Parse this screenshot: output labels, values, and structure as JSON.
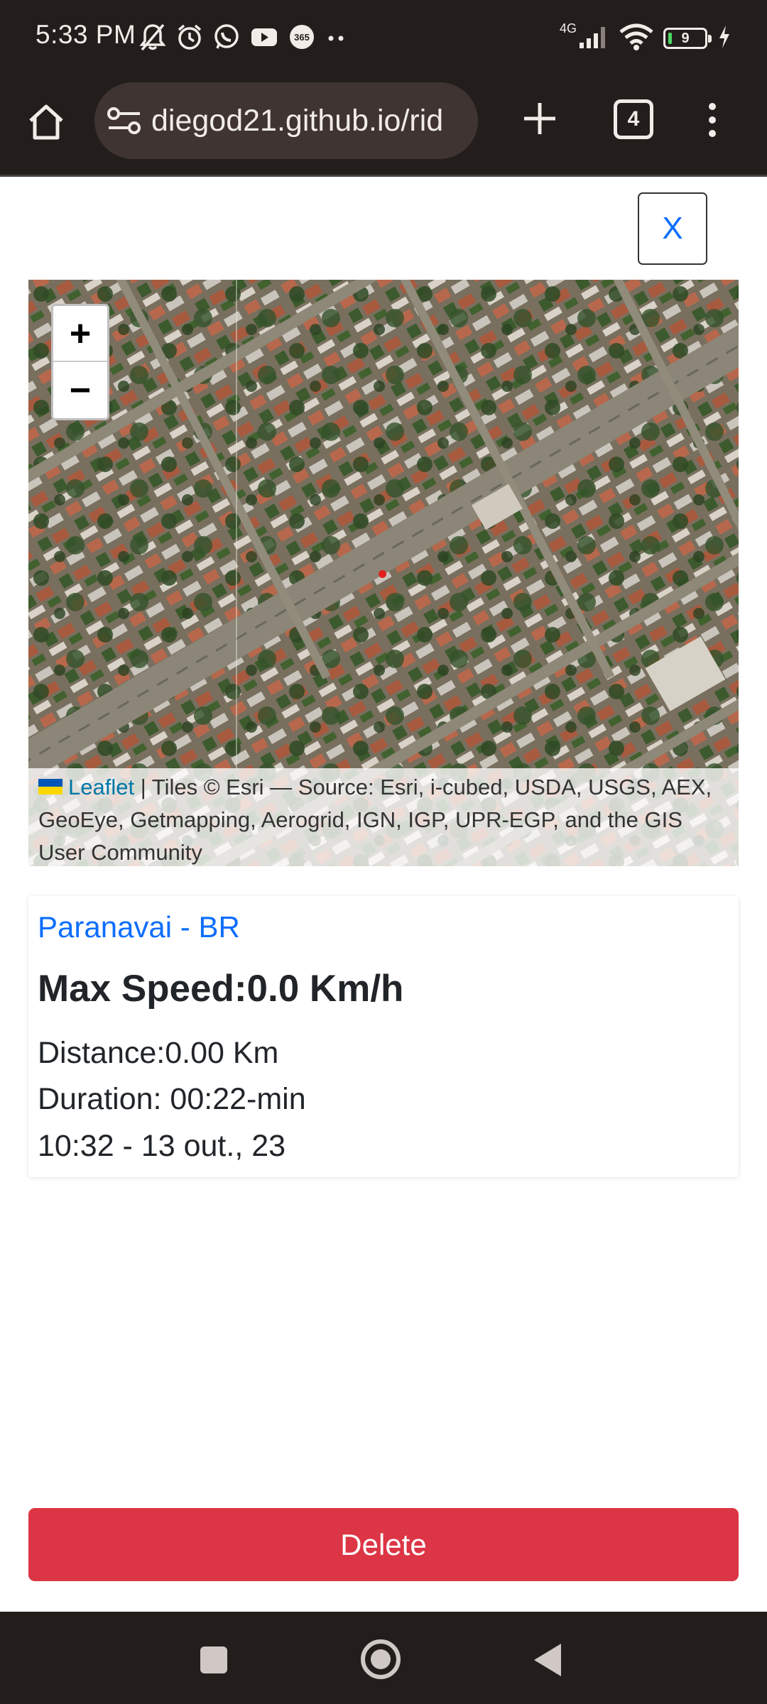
{
  "status_bar": {
    "time": "5:33 PM",
    "left_icons": [
      "bell-off-icon",
      "alarm-icon",
      "whatsapp-icon",
      "youtube-icon",
      "365-app-icon",
      "more-dots-icon"
    ],
    "network": "4G",
    "battery_level": "9"
  },
  "browser": {
    "url": "diegod21.github.io/rid",
    "tab_count": "4"
  },
  "close_button_label": "X",
  "map": {
    "zoom_in_label": "+",
    "zoom_out_label": "−",
    "attribution_link": "Leaflet",
    "attribution_text": " | Tiles © Esri — Source: Esri, i-cubed, USDA, USGS, AEX, GeoEye, Getmapping, Aerogrid, IGN, IGP, UPR-EGP, and the GIS User Community"
  },
  "ride": {
    "city": "Paranavai - BR",
    "max_speed": "Max Speed:0.0 Km/h",
    "distance": "Distance:0.00 Km",
    "duration": "Duration: 00:22-min",
    "datetime": "10:32 - 13 out., 23"
  },
  "delete_button_label": "Delete",
  "colors": {
    "system_bar": "#231e1c",
    "link_blue": "#0d6efd",
    "danger_red": "#dc3545"
  }
}
